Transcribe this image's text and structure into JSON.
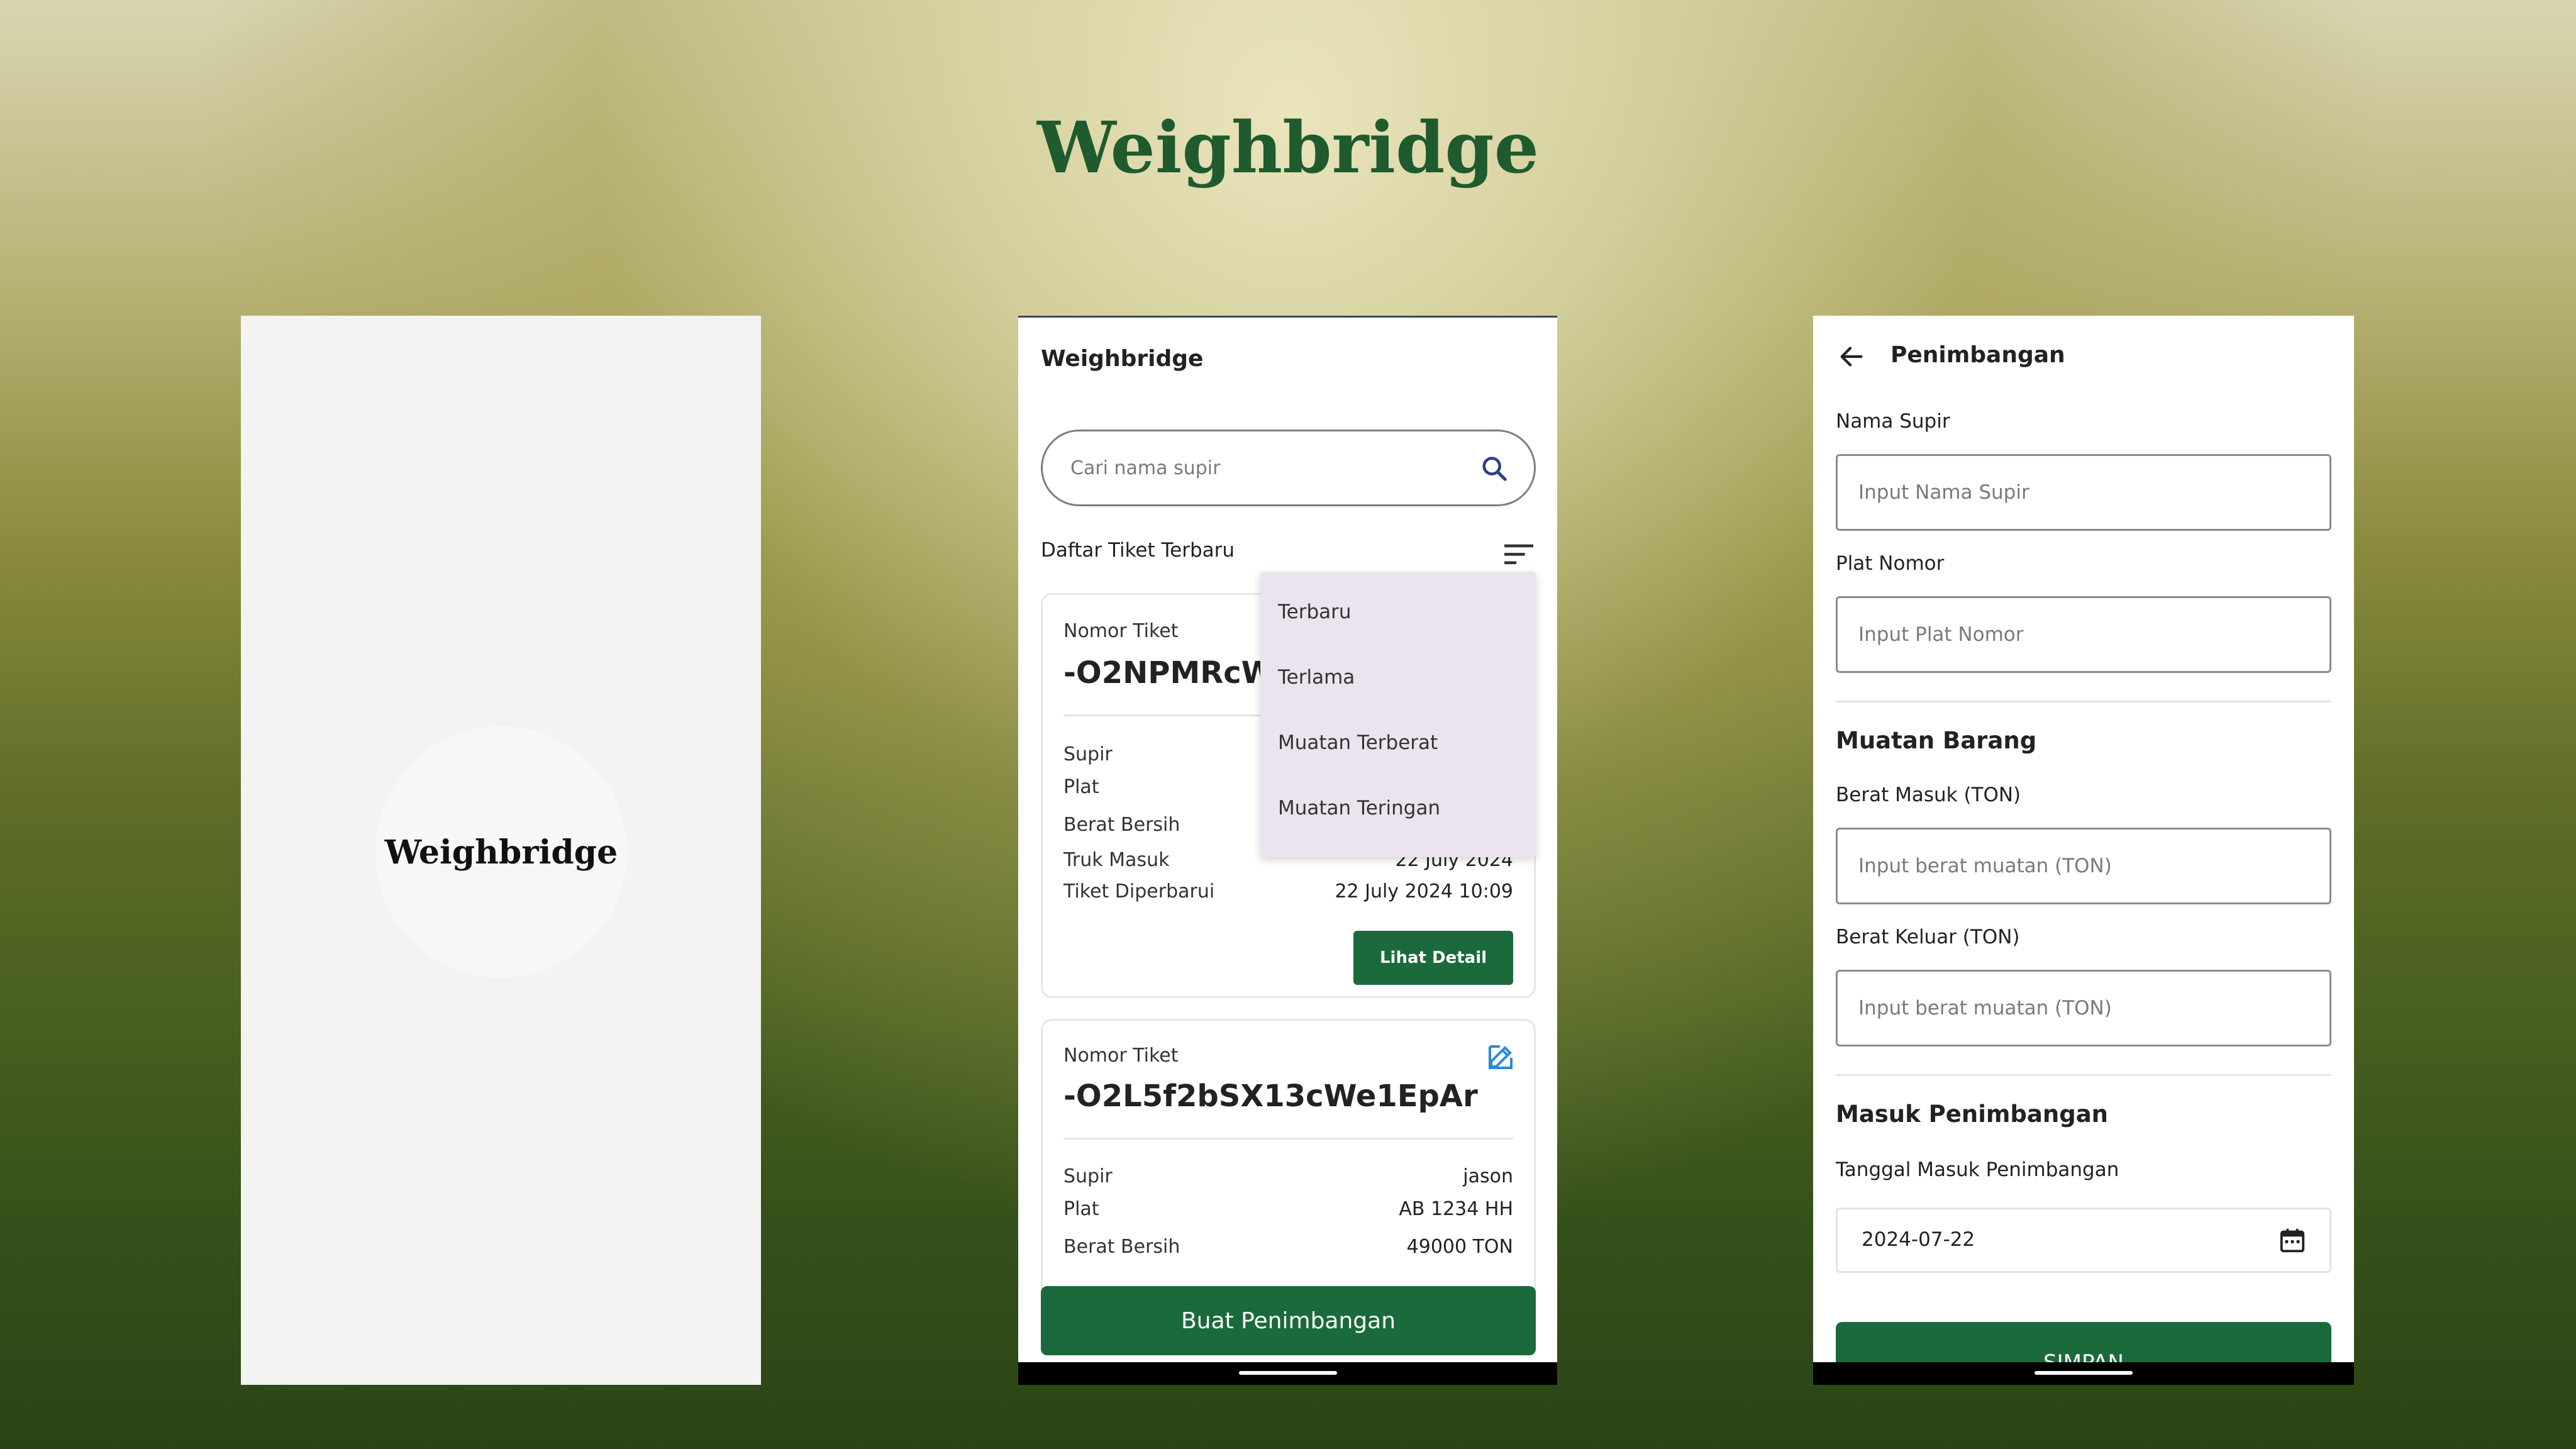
{
  "hero": {
    "title": "Weighbridge"
  },
  "splash": {
    "logo_text": "Weighbridge"
  },
  "list_screen": {
    "app_title": "Weighbridge",
    "search": {
      "placeholder": "Cari nama supir"
    },
    "section_title": "Daftar Tiket Terbaru",
    "sort_menu": {
      "options": [
        "Terbaru",
        "Terlama",
        "Muatan Terberat",
        "Muatan Teringan"
      ]
    },
    "tickets": [
      {
        "number_label": "Nomor Tiket",
        "number": "-O2NPMRcWl",
        "rows": [
          {
            "label": "Supir",
            "value": ""
          },
          {
            "label": "Plat",
            "value": ""
          },
          {
            "label": "Berat Bersih",
            "value": ""
          },
          {
            "label": "Truk Masuk",
            "value": "22 July 2024"
          },
          {
            "label": "Tiket Diperbarui",
            "value": "22 July 2024 10:09"
          }
        ],
        "detail_button": "Lihat Detail"
      },
      {
        "number_label": "Nomor Tiket",
        "number": "-O2L5f2bSX13cWe1EpAr",
        "rows": [
          {
            "label": "Supir",
            "value": "jason"
          },
          {
            "label": "Plat",
            "value": "AB 1234 HH"
          },
          {
            "label": "Berat Bersih",
            "value": "49000 TON"
          }
        ]
      }
    ],
    "create_button": "Buat Penimbangan"
  },
  "form_screen": {
    "app_title": "Penimbangan",
    "driver": {
      "label": "Nama Supir",
      "placeholder": "Input Nama Supir"
    },
    "plate": {
      "label": "Plat Nomor",
      "placeholder": "Input Plat Nomor"
    },
    "cargo_section": "Muatan Barang",
    "weight_in": {
      "label": "Berat Masuk (TON)",
      "placeholder": "Input berat muatan (TON)"
    },
    "weight_out": {
      "label": "Berat Keluar (TON)",
      "placeholder": "Input berat muatan (TON)"
    },
    "entry_section": "Masuk Penimbangan",
    "entry_date": {
      "label": "Tanggal Masuk Penimbangan",
      "value": "2024-07-22"
    },
    "save_button": "SIMPAN"
  },
  "colors": {
    "brand_green": "#1b6a3b",
    "title_green": "#1f5b2e",
    "menu_bg": "#ebe4ee"
  }
}
